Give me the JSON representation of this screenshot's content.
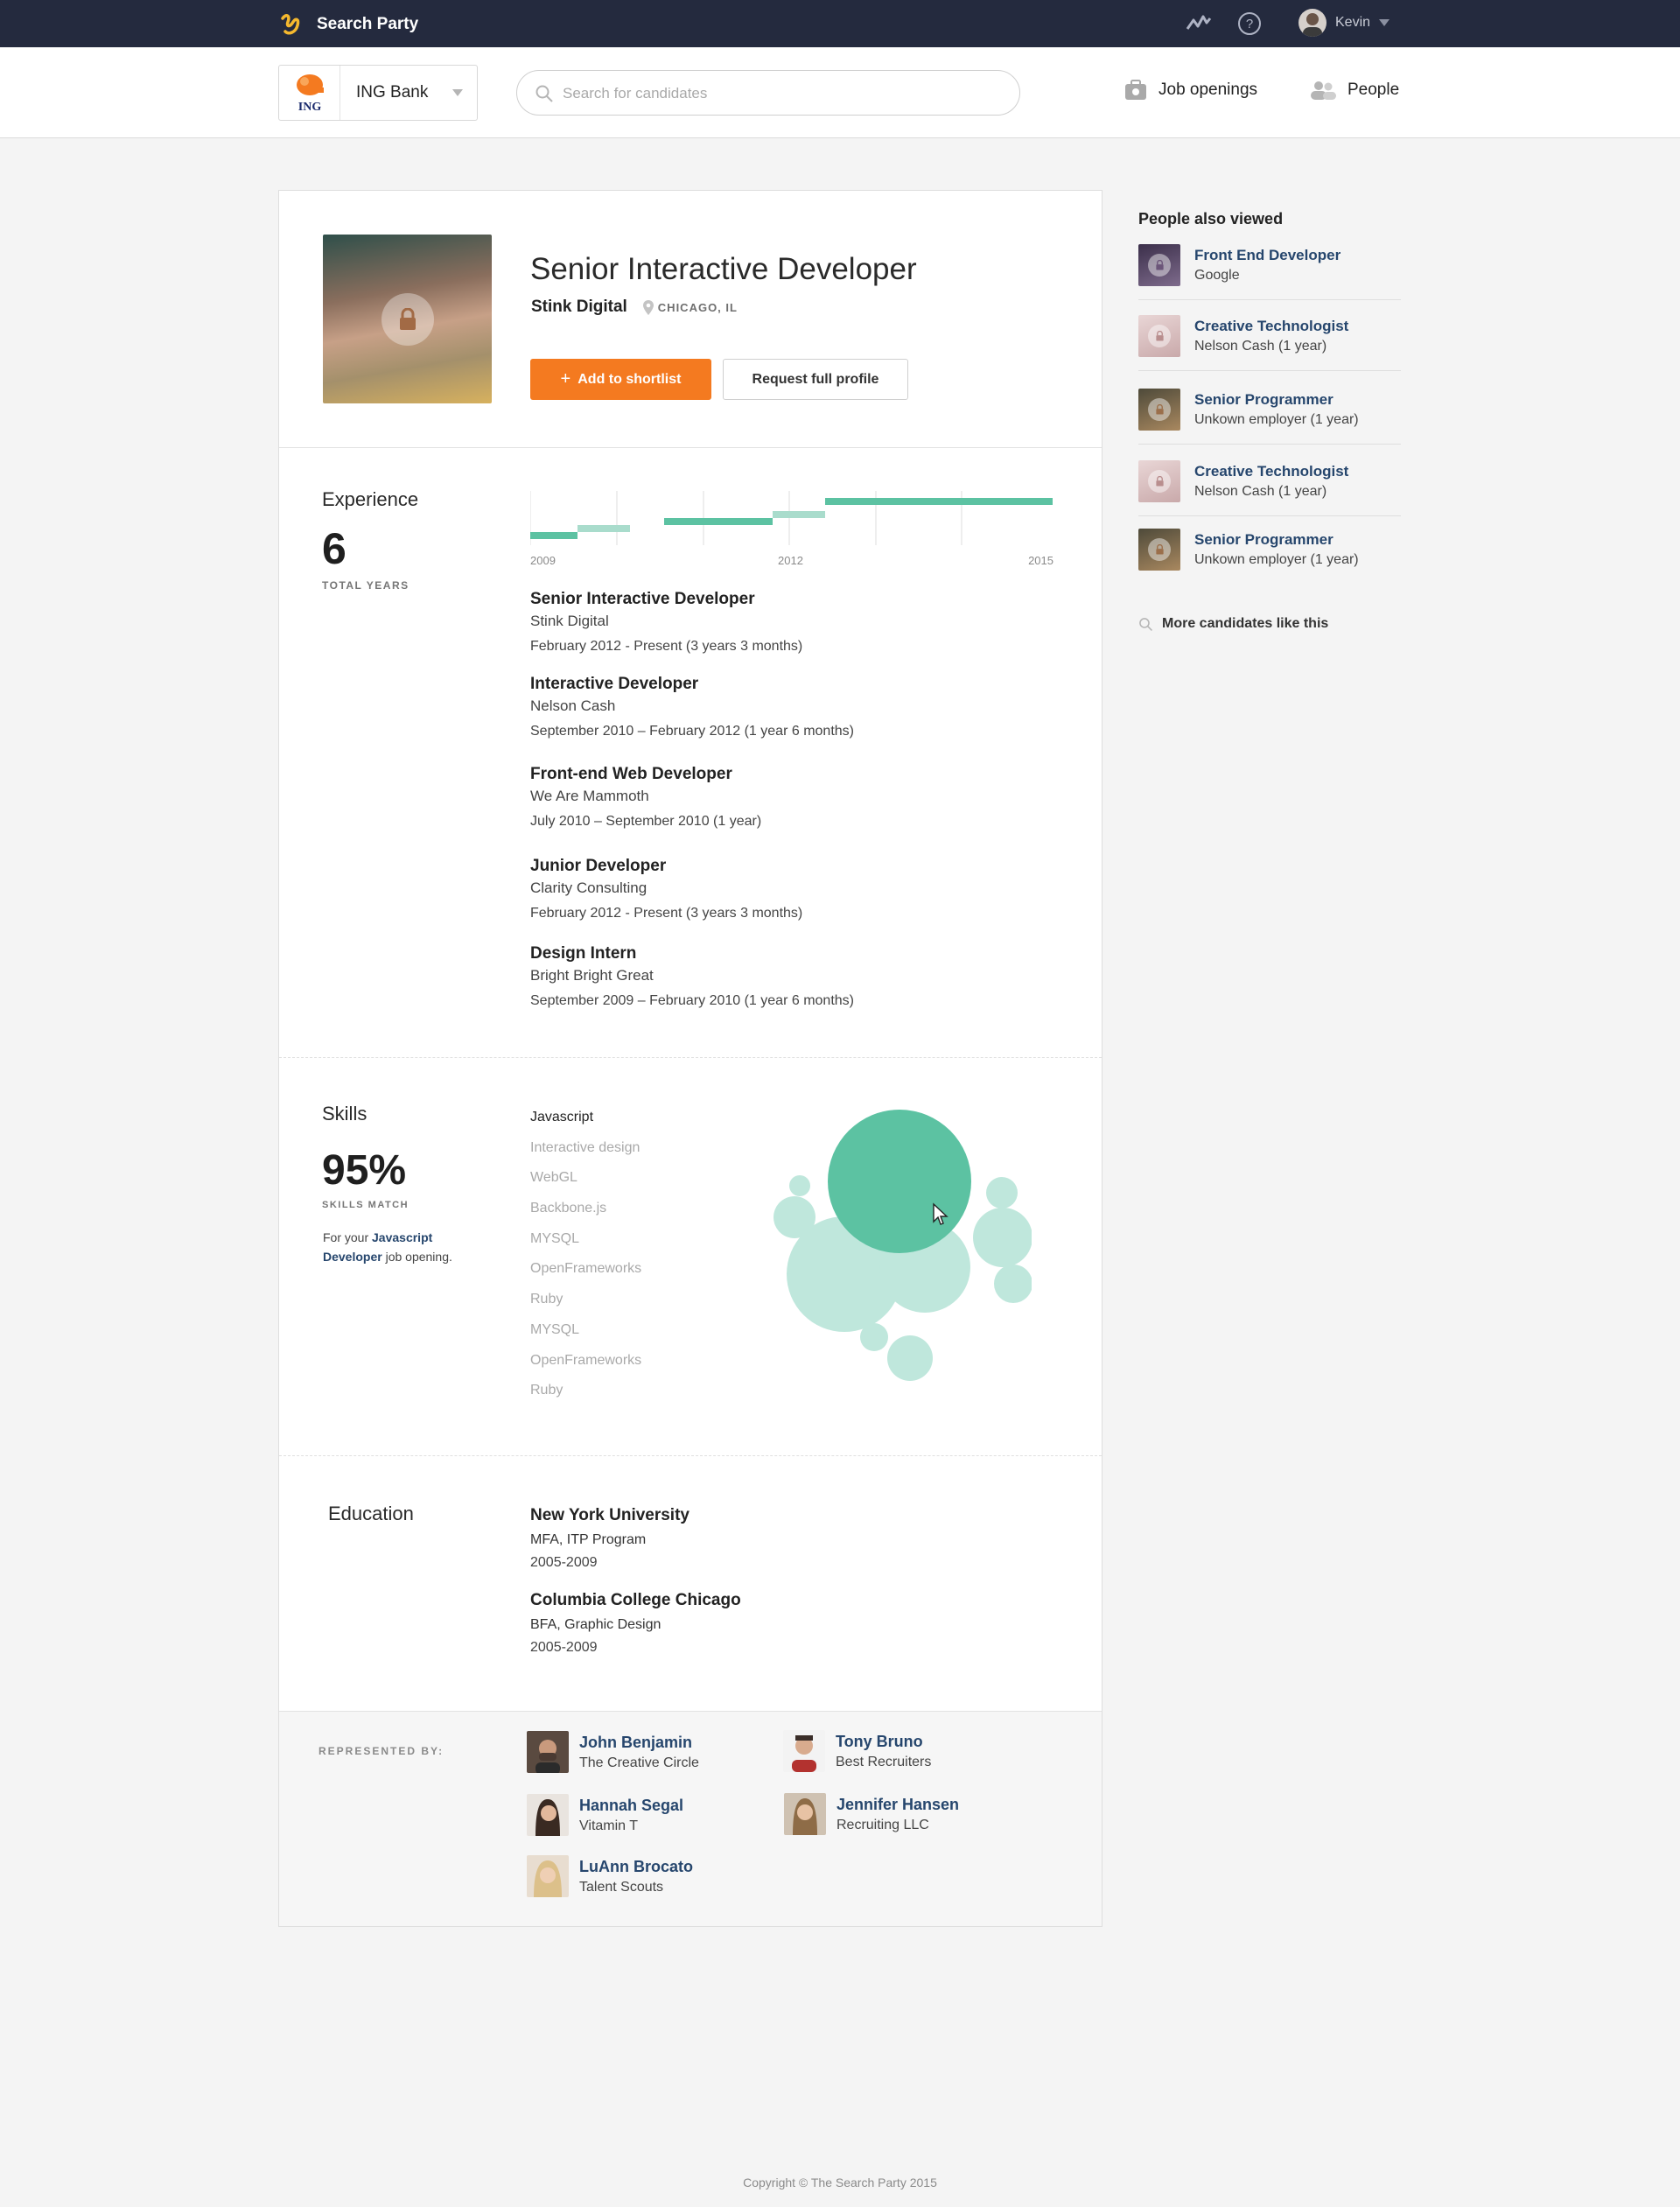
{
  "topbar": {
    "app_name": "Search Party",
    "user_name": "Kevin",
    "icons": [
      "pulse-icon",
      "help-icon",
      "caret-icon"
    ]
  },
  "header": {
    "company_name": "ING Bank",
    "company_logo_text": "ING",
    "search_placeholder": "Search for candidates",
    "nav": {
      "job_openings": "Job openings",
      "people": "People"
    }
  },
  "profile": {
    "title": "Senior Interactive Developer",
    "company": "Stink Digital",
    "location": "CHICAGO, IL",
    "add_button": "Add to shortlist",
    "request_button": "Request full profile"
  },
  "experience": {
    "section_title": "Experience",
    "total_years": "6",
    "total_label": "TOTAL YEARS",
    "axis_labels": [
      "2009",
      "2012",
      "2015"
    ],
    "items": [
      {
        "title": "Senior Interactive Developer",
        "company": "Stink Digital",
        "dates": "February 2012 - Present (3 years 3 months)"
      },
      {
        "title": "Interactive Developer",
        "company": "Nelson Cash",
        "dates": "September 2010 – February 2012 (1 year 6 months)"
      },
      {
        "title": "Front-end Web Developer",
        "company": "We Are Mammoth",
        "dates": "July 2010 – September 2010 (1 year)"
      },
      {
        "title": "Junior Developer",
        "company": "Clarity Consulting",
        "dates": "February 2012 - Present (3 years 3 months)"
      },
      {
        "title": "Design Intern",
        "company": "Bright Bright Great",
        "dates": "September 2009 – February 2010 (1 year 6 months)"
      }
    ]
  },
  "skills": {
    "section_title": "Skills",
    "match_percent": "95%",
    "match_label": "SKILLS MATCH",
    "match_prefix": "For your",
    "match_link": "Javascript Developer",
    "match_suffix": "job opening.",
    "list": [
      "Javascript",
      "Interactive design",
      "WebGL",
      "Backbone.js",
      "MYSQL",
      "OpenFrameworks",
      "Ruby",
      "MYSQL",
      "OpenFrameworks",
      "Ruby"
    ],
    "colors": {
      "primary": "#5cc2a2",
      "secondary": "#bfe7dc"
    }
  },
  "education": {
    "section_title": "Education",
    "items": [
      {
        "school": "New York University",
        "program": "MFA, ITP Program",
        "years": "2005-2009"
      },
      {
        "school": "Columbia College Chicago",
        "program": "BFA, Graphic Design",
        "years": "2005-2009"
      }
    ]
  },
  "represented": {
    "label": "REPRESENTED BY:",
    "recruiters": [
      {
        "name": "John Benjamin",
        "org": "The Creative Circle"
      },
      {
        "name": "Tony Bruno",
        "org": "Best Recruiters"
      },
      {
        "name": "Hannah Segal",
        "org": "Vitamin T"
      },
      {
        "name": "Jennifer Hansen",
        "org": "Recruiting LLC"
      },
      {
        "name": "LuAnn Brocato",
        "org": "Talent Scouts"
      }
    ]
  },
  "sidebar": {
    "title": "People also viewed",
    "items": [
      {
        "title": "Front End Developer",
        "org": "Google"
      },
      {
        "title": "Creative Technologist",
        "org": "Nelson Cash (1 year)"
      },
      {
        "title": "Senior Programmer",
        "org": "Unkown employer (1 year)"
      },
      {
        "title": "Creative Technologist",
        "org": "Nelson Cash (1 year)"
      },
      {
        "title": "Senior Programmer",
        "org": "Unkown employer (1 year)"
      }
    ],
    "more_link": "More candidates like this"
  },
  "footer": {
    "copyright": "Copyright © The Search Party 2015"
  },
  "colors": {
    "topbar": "#242a3e",
    "accent": "#f47a20",
    "link": "#26466d",
    "green": "#5cc2a2"
  }
}
